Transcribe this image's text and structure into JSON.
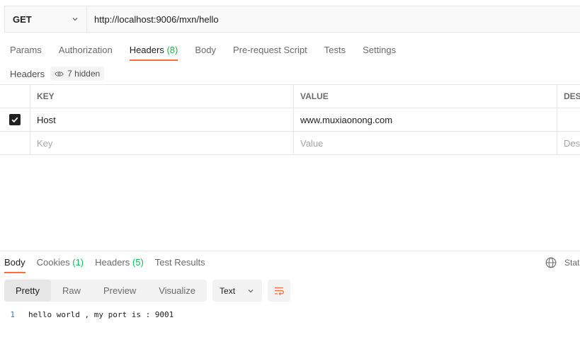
{
  "request": {
    "method": "GET",
    "url": "http://localhost:9006/mxn/hello"
  },
  "request_tabs": [
    {
      "label": "Params"
    },
    {
      "label": "Authorization"
    },
    {
      "label": "Headers",
      "count": "(8)"
    },
    {
      "label": "Body"
    },
    {
      "label": "Pre-request Script"
    },
    {
      "label": "Tests"
    },
    {
      "label": "Settings"
    }
  ],
  "headers_section": {
    "title": "Headers",
    "hidden_label": "7 hidden"
  },
  "table": {
    "columns": [
      "KEY",
      "VALUE",
      "DES"
    ],
    "rows": [
      {
        "checked": true,
        "key": "Host",
        "value": "www.muxiaonong.com",
        "description": ""
      }
    ],
    "placeholders": {
      "key": "Key",
      "value": "Value",
      "description": "Desc"
    }
  },
  "response_tabs": [
    {
      "label": "Body"
    },
    {
      "label": "Cookies",
      "count": "(1)"
    },
    {
      "label": "Headers",
      "count": "(5)"
    },
    {
      "label": "Test Results"
    }
  ],
  "status_label": "Stat",
  "view_modes": [
    "Pretty",
    "Raw",
    "Preview",
    "Visualize"
  ],
  "format": "Text",
  "response_body": {
    "line_number": "1",
    "text": "hello world , my port is : 9001"
  },
  "colors": {
    "accent": "#ff6c37",
    "count": "#0cbb52"
  },
  "icons": [
    "chevron-down-icon",
    "eye-icon",
    "check-icon",
    "globe-icon",
    "wrap-lines-icon"
  ]
}
